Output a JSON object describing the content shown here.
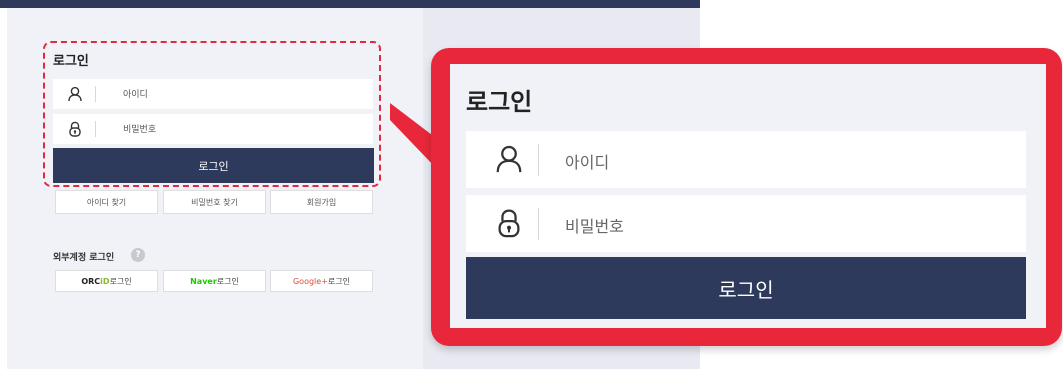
{
  "login_title": "로그인",
  "id_placeholder": "아이디",
  "password_placeholder": "비밀번호",
  "login_button": "로그인",
  "links": {
    "find_id": "아이디 찾기",
    "find_password": "비밀번호 찾기",
    "signup": "회원가입"
  },
  "external": {
    "title": "외부계정 로그인",
    "help_glyph": "?",
    "orcid_brand": "ORC",
    "orcid_id": "iD",
    "orcid_suffix": "로그인",
    "naver_brand": "Naver",
    "naver_suffix": "로그인",
    "google_brand": "Google+",
    "google_suffix": "로그인"
  },
  "zoom": {
    "title": "로그인",
    "id_placeholder": "아이디",
    "password_placeholder": "비밀번호",
    "login_button": "로그인"
  },
  "icons": {
    "user": "user-icon",
    "lock": "lock-icon",
    "help": "help-icon"
  },
  "colors": {
    "navy": "#2e3a5c",
    "highlight_red": "#e8273a",
    "naver_green": "#1ec800",
    "google_red": "#e04a3a",
    "orcid_green": "#8bb933"
  }
}
